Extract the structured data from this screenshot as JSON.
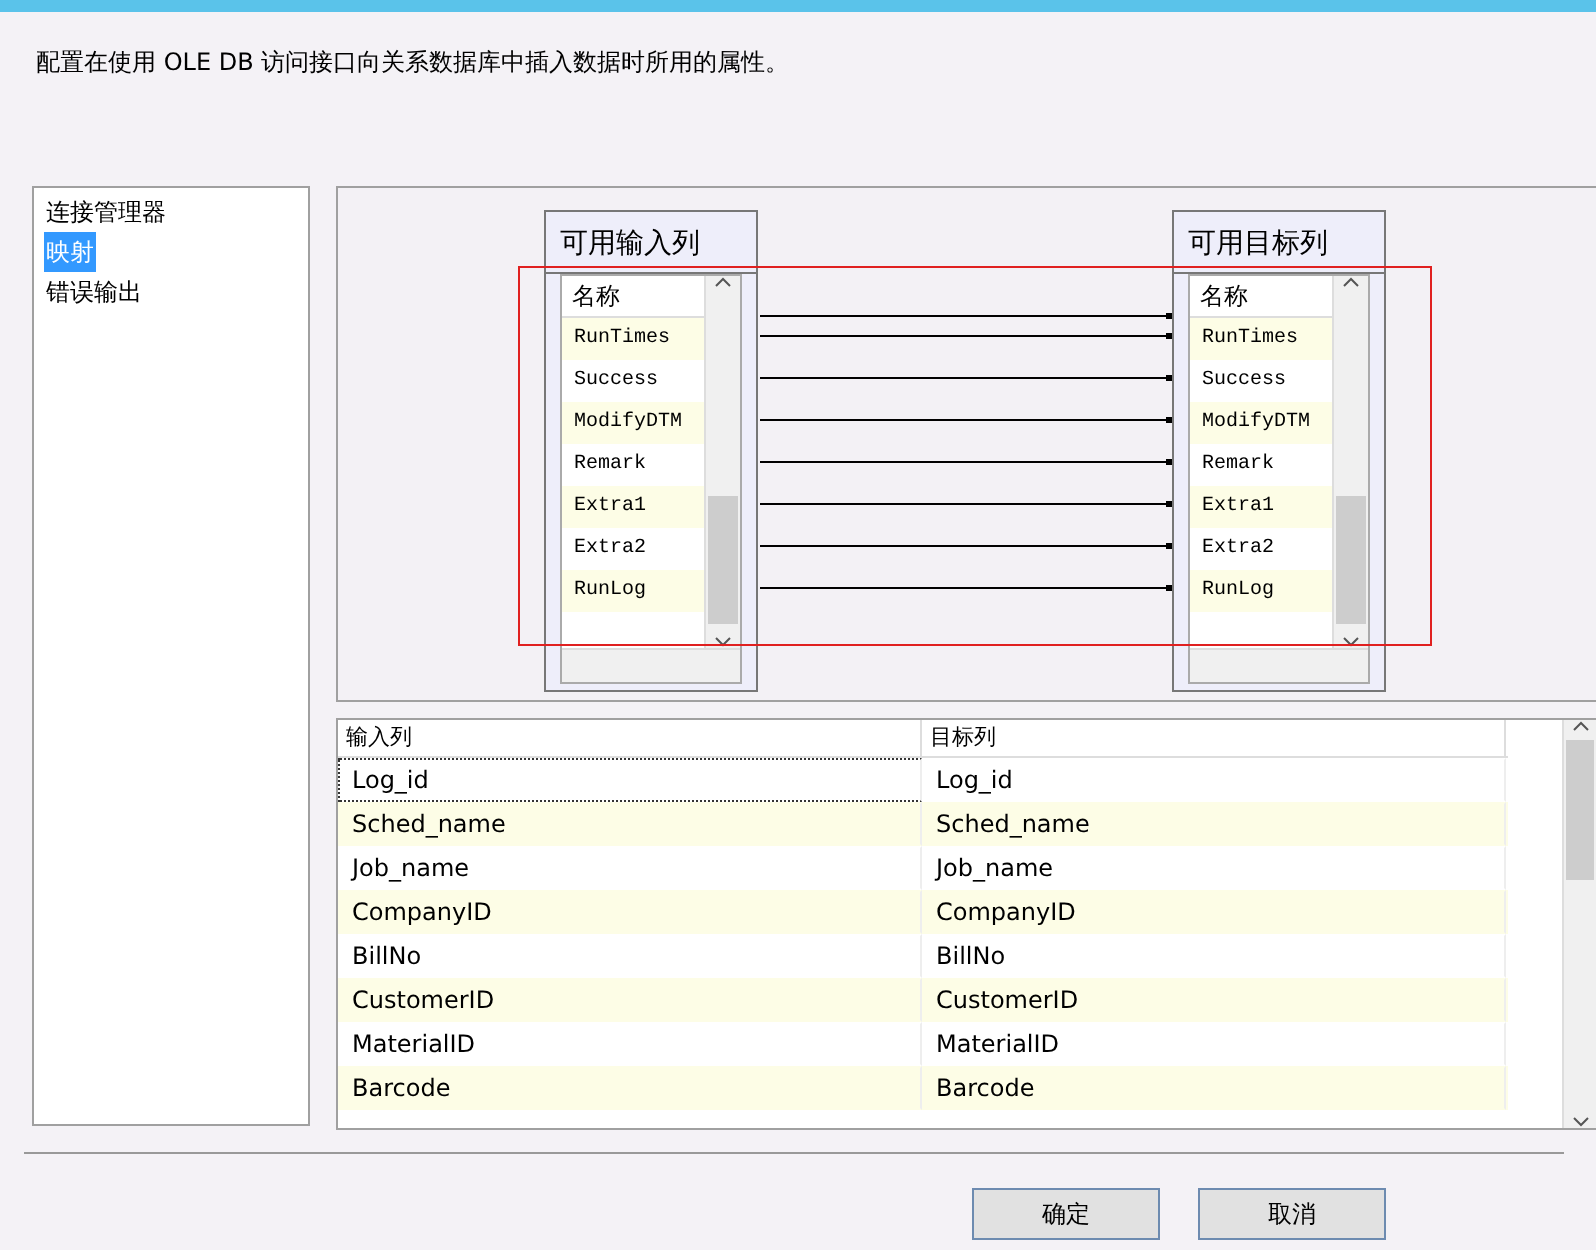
{
  "description": "配置在使用 OLE DB 访问接口向关系数据库中插入数据时所用的属性。",
  "nav": [
    {
      "label": "连接管理器",
      "selected": false
    },
    {
      "label": "映射",
      "selected": true
    },
    {
      "label": "错误输出",
      "selected": false
    }
  ],
  "mapping": {
    "tables": [
      {
        "title": "可用输入列",
        "header": "名称",
        "rows": [
          "RunTimes",
          "Success",
          "ModifyDTM",
          "Remark",
          "Extra1",
          "Extra2",
          "RunLog"
        ]
      },
      {
        "title": "可用目标列",
        "header": "名称",
        "rows": [
          "RunTimes",
          "Success",
          "ModifyDTM",
          "Remark",
          "Extra1",
          "Extra2",
          "RunLog"
        ]
      }
    ]
  },
  "grid": {
    "columns": [
      "输入列",
      "目标列"
    ],
    "rows": [
      [
        "Log_id",
        "Log_id"
      ],
      [
        "Sched_name",
        "Sched_name"
      ],
      [
        "Job_name",
        "Job_name"
      ],
      [
        "CompanyID",
        "CompanyID"
      ],
      [
        "BillNo",
        "BillNo"
      ],
      [
        "CustomerID",
        "CustomerID"
      ],
      [
        "MaterialID",
        "MaterialID"
      ],
      [
        "Barcode",
        "Barcode"
      ]
    ]
  },
  "buttons": [
    "确定",
    "取消"
  ]
}
